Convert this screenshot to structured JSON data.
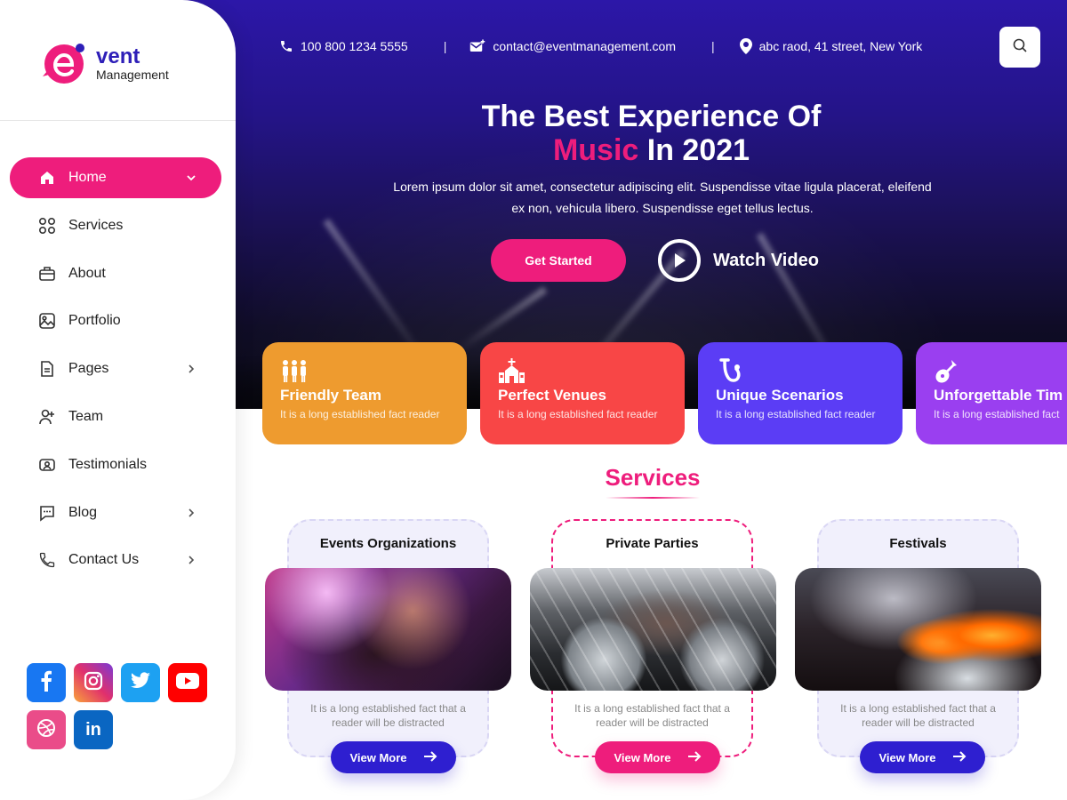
{
  "brand": {
    "logo_letter": "e",
    "name_line1": "vent",
    "name_line2": "Management",
    "primary_color": "#2e1fd0",
    "accent_color": "#ee1d7c"
  },
  "topbar": {
    "phone": "100 800 1234 5555",
    "email": "contact@eventmanagement.com",
    "address": "abc raod, 41 street, New York",
    "separator": "|",
    "search_icon": "search-icon"
  },
  "hero": {
    "title_line1": "The Best Experience Of",
    "title_accent": "Music",
    "title_rest": "In 2021",
    "description": "Lorem ipsum dolor sit amet, consectetur adipiscing elit. Suspendisse vitae ligula placerat, eleifend ex non, vehicula libero. Suspendisse eget tellus lectus.",
    "cta_label": "Get Started",
    "video_label": "Watch Video"
  },
  "sidebar": {
    "items": [
      {
        "label": "Home",
        "icon": "home-icon",
        "active": true,
        "chevron": "down"
      },
      {
        "label": "Services",
        "icon": "grid-icon",
        "active": false,
        "chevron": ""
      },
      {
        "label": "About",
        "icon": "briefcase-icon",
        "active": false,
        "chevron": ""
      },
      {
        "label": "Portfolio",
        "icon": "image-icon",
        "active": false,
        "chevron": ""
      },
      {
        "label": "Pages",
        "icon": "document-icon",
        "active": false,
        "chevron": "right"
      },
      {
        "label": "Team",
        "icon": "user-add-icon",
        "active": false,
        "chevron": ""
      },
      {
        "label": "Testimonials",
        "icon": "testimonial-icon",
        "active": false,
        "chevron": ""
      },
      {
        "label": "Blog",
        "icon": "chat-icon",
        "active": false,
        "chevron": "right"
      },
      {
        "label": "Contact Us",
        "icon": "phone-icon",
        "active": false,
        "chevron": "right"
      }
    ],
    "socials": [
      {
        "name": "facebook",
        "icon": "facebook-icon",
        "color": "#1877f2",
        "glyph": "f"
      },
      {
        "name": "instagram",
        "icon": "instagram-icon",
        "color": "#c13584",
        "glyph": ""
      },
      {
        "name": "twitter",
        "icon": "twitter-icon",
        "color": "#1da1f2",
        "glyph": ""
      },
      {
        "name": "youtube",
        "icon": "youtube-icon",
        "color": "#ff0000",
        "glyph": ""
      },
      {
        "name": "dribbble",
        "icon": "dribbble-icon",
        "color": "#ea4c89",
        "glyph": ""
      },
      {
        "name": "linkedin",
        "icon": "linkedin-icon",
        "color": "#0a66c2",
        "glyph": "in"
      }
    ]
  },
  "features": [
    {
      "title": "Friendly Team",
      "desc": "It is a long established fact reader",
      "icon": "team-icon",
      "color": "#ee9b2f"
    },
    {
      "title": "Perfect Venues",
      "desc": "It is a long established fact reader",
      "icon": "venue-icon",
      "color": "#f84646"
    },
    {
      "title": "Unique Scenarios",
      "desc": "It is a long established fact reader",
      "icon": "saxophone-icon",
      "color": "#5b3df5"
    },
    {
      "title": "Unforgettable Tim",
      "desc": "It is a long established fact",
      "icon": "guitar-icon",
      "color": "#9a3ff0"
    }
  ],
  "services": {
    "heading": "Services",
    "cards": [
      {
        "title": "Events Organizations",
        "desc": "It is a long established fact that a reader will be distracted",
        "button": "View More",
        "highlight": false
      },
      {
        "title": "Private Parties",
        "desc": "It is a long established fact that a reader will be distracted",
        "button": "View More",
        "highlight": true
      },
      {
        "title": "Festivals",
        "desc": "It is a long established fact that a reader will be distracted",
        "button": "View More",
        "highlight": false
      }
    ]
  }
}
